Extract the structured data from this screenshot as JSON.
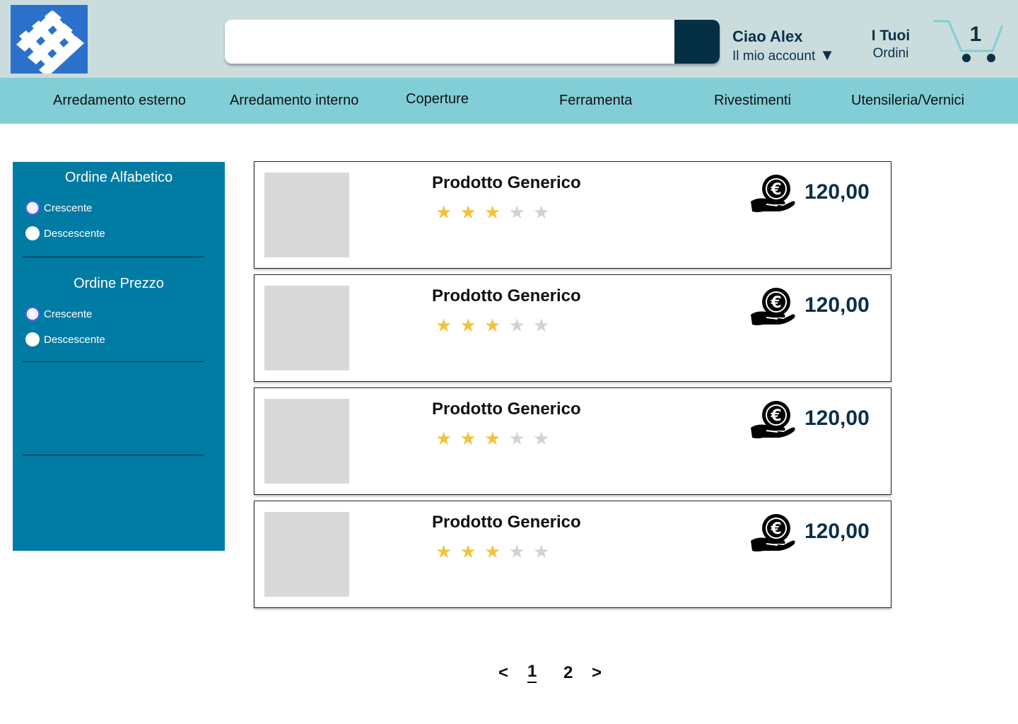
{
  "header": {
    "search": {
      "placeholder": "",
      "value": ""
    },
    "account": {
      "greeting": "Ciao Alex",
      "link": "Il mio account",
      "caret": "▼"
    },
    "orders": {
      "title": "I Tuoi",
      "subtitle": "Ordini"
    },
    "cart": {
      "count": "1"
    }
  },
  "categories": [
    "Arredamento esterno",
    "Arredamento interno",
    "Coperture",
    "Ferramenta",
    "Rivestimenti",
    "Utensileria/Vernici"
  ],
  "sidebar": {
    "groups": [
      {
        "title": "Ordine Alfabetico",
        "options": [
          "Crescente",
          "Descescente"
        ],
        "selected": "Crescente"
      },
      {
        "title": "Ordine Prezzo",
        "options": [
          "Crescente",
          "Descescente"
        ],
        "selected": "Crescente"
      }
    ]
  },
  "products": [
    {
      "name": "Prodotto Generico",
      "rating": 3,
      "max_rating": 5,
      "price": "120,00",
      "price_icon": "euro-coin-hand-icon"
    },
    {
      "name": "Prodotto Generico",
      "rating": 3,
      "max_rating": 5,
      "price": "120,00",
      "price_icon": "euro-coin-hand-icon"
    },
    {
      "name": "Prodotto Generico",
      "rating": 3,
      "max_rating": 5,
      "price": "120,00",
      "price_icon": "euro-coin-hand-icon"
    },
    {
      "name": "Prodotto Generico",
      "rating": 3,
      "max_rating": 5,
      "price": "120,00",
      "price_icon": "euro-coin-hand-icon"
    }
  ],
  "pagination": {
    "prev": "<",
    "pages": [
      "1",
      "2"
    ],
    "current": "1",
    "next": ">"
  },
  "colors": {
    "header_bg": "#cbdcdd",
    "logo_bg": "#2b71cc",
    "nav_bg": "#81ced7",
    "sidebar_bg": "#007ba4",
    "search_button": "#042f45",
    "text_dark": "#0a3049",
    "star_on": "#f3c33d",
    "star_off": "#d2d2d2",
    "cart_icon": "#81ced7"
  }
}
